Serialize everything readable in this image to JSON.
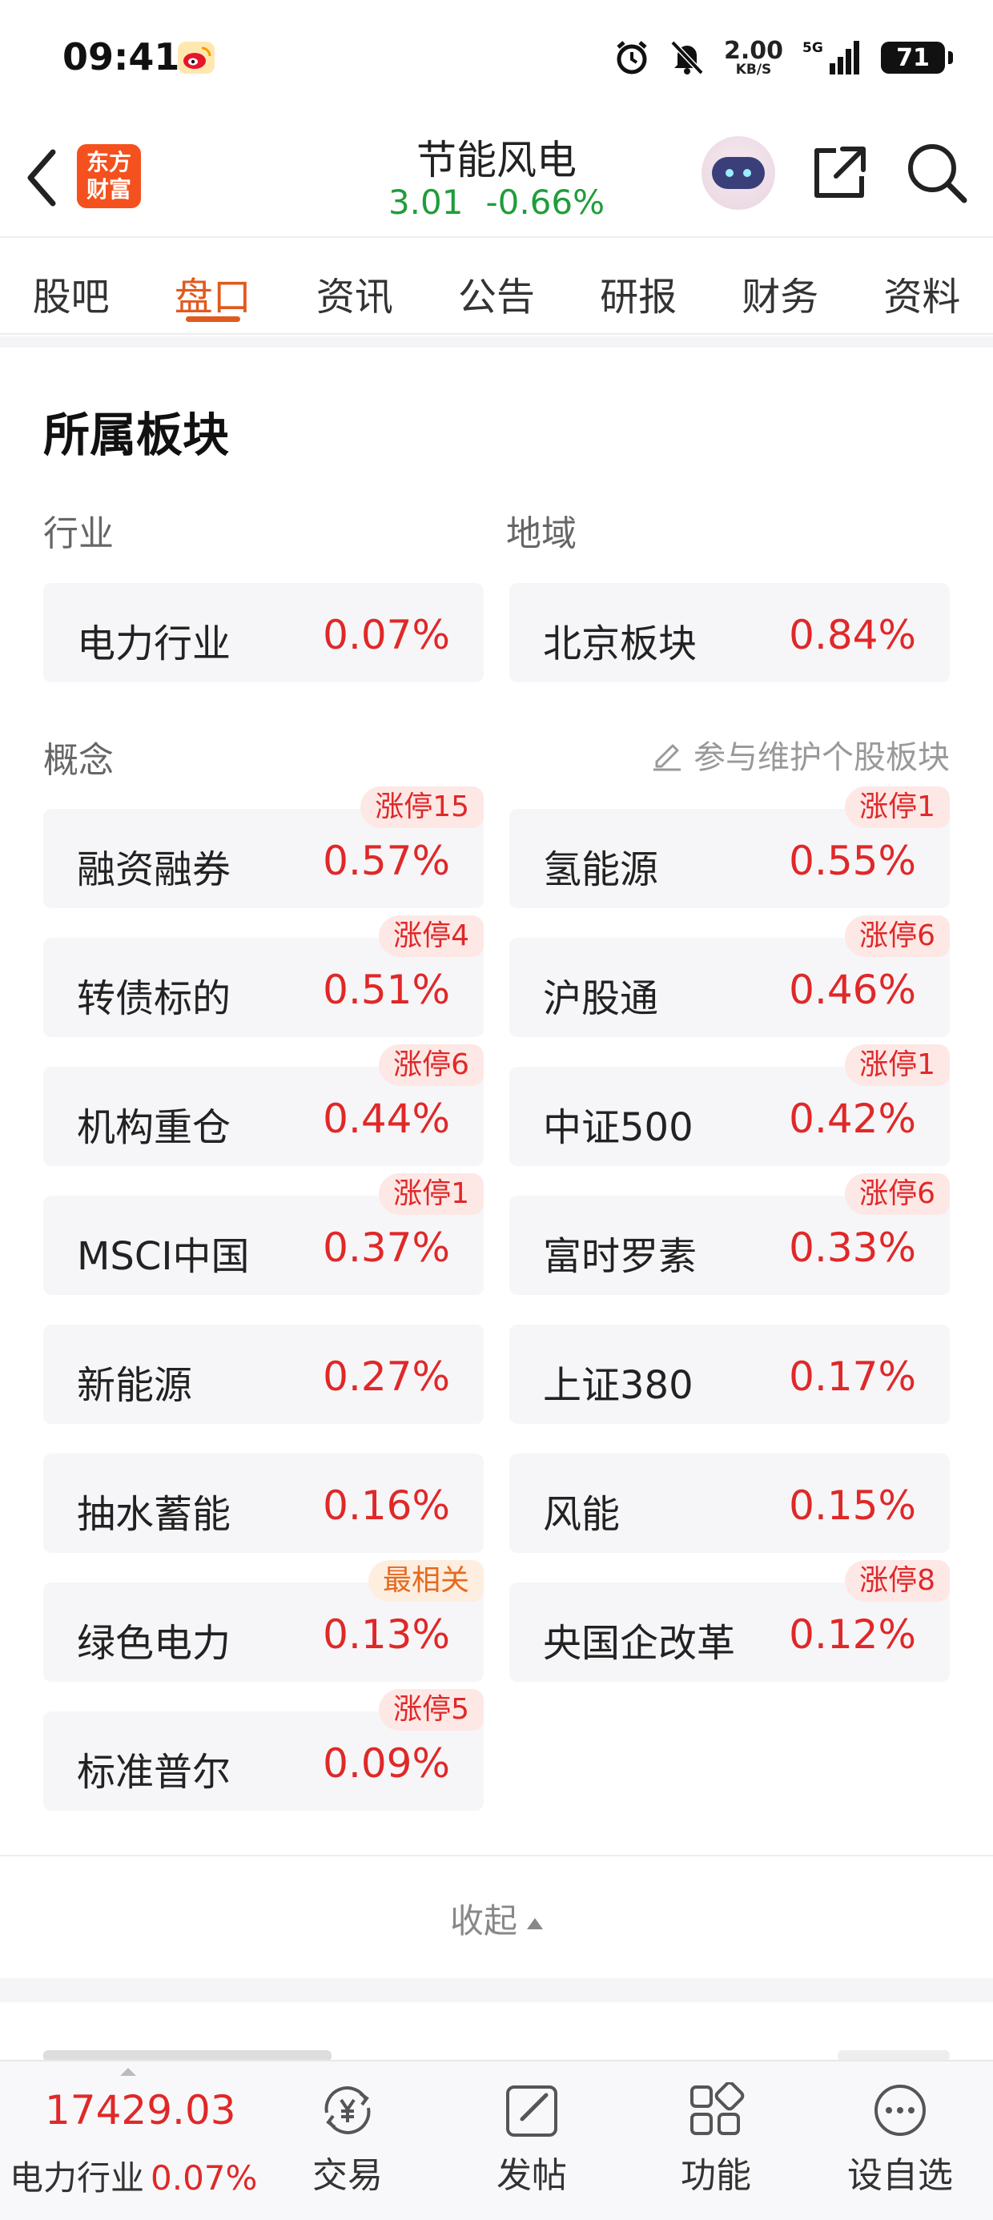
{
  "status_bar": {
    "time": "09:41",
    "net_speed": "2.00",
    "net_unit": "KB/S",
    "network": "5G",
    "battery": "71"
  },
  "header": {
    "stock_name": "节能风电",
    "price": "3.01",
    "change_pct": "-0.66%",
    "logo_text": "东方财富"
  },
  "tabs": [
    "股吧",
    "盘口",
    "资讯",
    "公告",
    "研报",
    "财务",
    "资料"
  ],
  "active_tab": "盘口",
  "section": {
    "title": "所属板块",
    "industry_label": "行业",
    "region_label": "地域",
    "concept_label": "概念",
    "maintain_link": "参与维护个股板块",
    "industry": {
      "name": "电力行业",
      "pct": "0.07%"
    },
    "region": {
      "name": "北京板块",
      "pct": "0.84%"
    },
    "concepts": [
      {
        "name": "融资融券",
        "pct": "0.57%",
        "tag": "涨停15"
      },
      {
        "name": "氢能源",
        "pct": "0.55%",
        "tag": "涨停1"
      },
      {
        "name": "转债标的",
        "pct": "0.51%",
        "tag": "涨停4"
      },
      {
        "name": "沪股通",
        "pct": "0.46%",
        "tag": "涨停6"
      },
      {
        "name": "机构重仓",
        "pct": "0.44%",
        "tag": "涨停6"
      },
      {
        "name": "中证500",
        "pct": "0.42%",
        "tag": "涨停1"
      },
      {
        "name": "MSCI中国",
        "pct": "0.37%",
        "tag": "涨停1"
      },
      {
        "name": "富时罗素",
        "pct": "0.33%",
        "tag": "涨停6"
      },
      {
        "name": "新能源",
        "pct": "0.27%",
        "tag": ""
      },
      {
        "name": "上证380",
        "pct": "0.17%",
        "tag": ""
      },
      {
        "name": "抽水蓄能",
        "pct": "0.16%",
        "tag": ""
      },
      {
        "name": "风能",
        "pct": "0.15%",
        "tag": ""
      },
      {
        "name": "绿色电力",
        "pct": "0.13%",
        "tag": "最相关"
      },
      {
        "name": "央国企改革",
        "pct": "0.12%",
        "tag": "涨停8"
      },
      {
        "name": "标准普尔",
        "pct": "0.09%",
        "tag": "涨停5"
      }
    ],
    "collapse_label": "收起"
  },
  "bottom_bar": {
    "index_value": "17429.03",
    "index_name": "电力行业",
    "index_pct": "0.07%",
    "buttons": [
      "交易",
      "发帖",
      "功能",
      "设自选"
    ]
  },
  "colors": {
    "accent": "#e05a1f",
    "up": "#e02828",
    "down": "#1f9d3a"
  }
}
